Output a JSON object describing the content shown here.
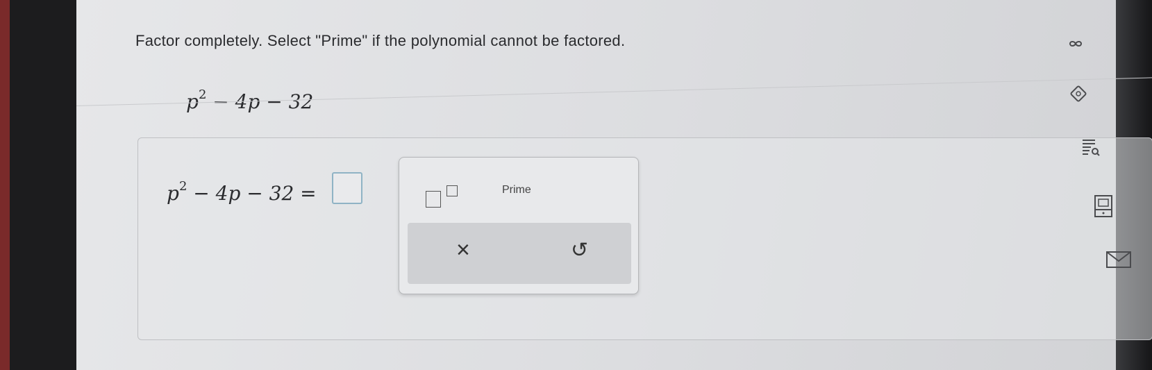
{
  "question": {
    "prompt": "Factor completely. Select \"Prime\" if the polynomial cannot be factored.",
    "expression": {
      "base": "p",
      "exp": "2",
      "rest": " − 4p − 32"
    }
  },
  "answer": {
    "lhs_base": "p",
    "lhs_exp": "2",
    "lhs_rest": " − 4p − 32 ="
  },
  "keypad": {
    "exponent_button": "exponent-template",
    "prime_label": "Prime",
    "clear_symbol": "×",
    "undo_symbol": "↺"
  },
  "sidebar_icons": [
    "infinity-icon",
    "tag-icon",
    "text-search-icon",
    "calculator-icon",
    "mail-icon"
  ]
}
